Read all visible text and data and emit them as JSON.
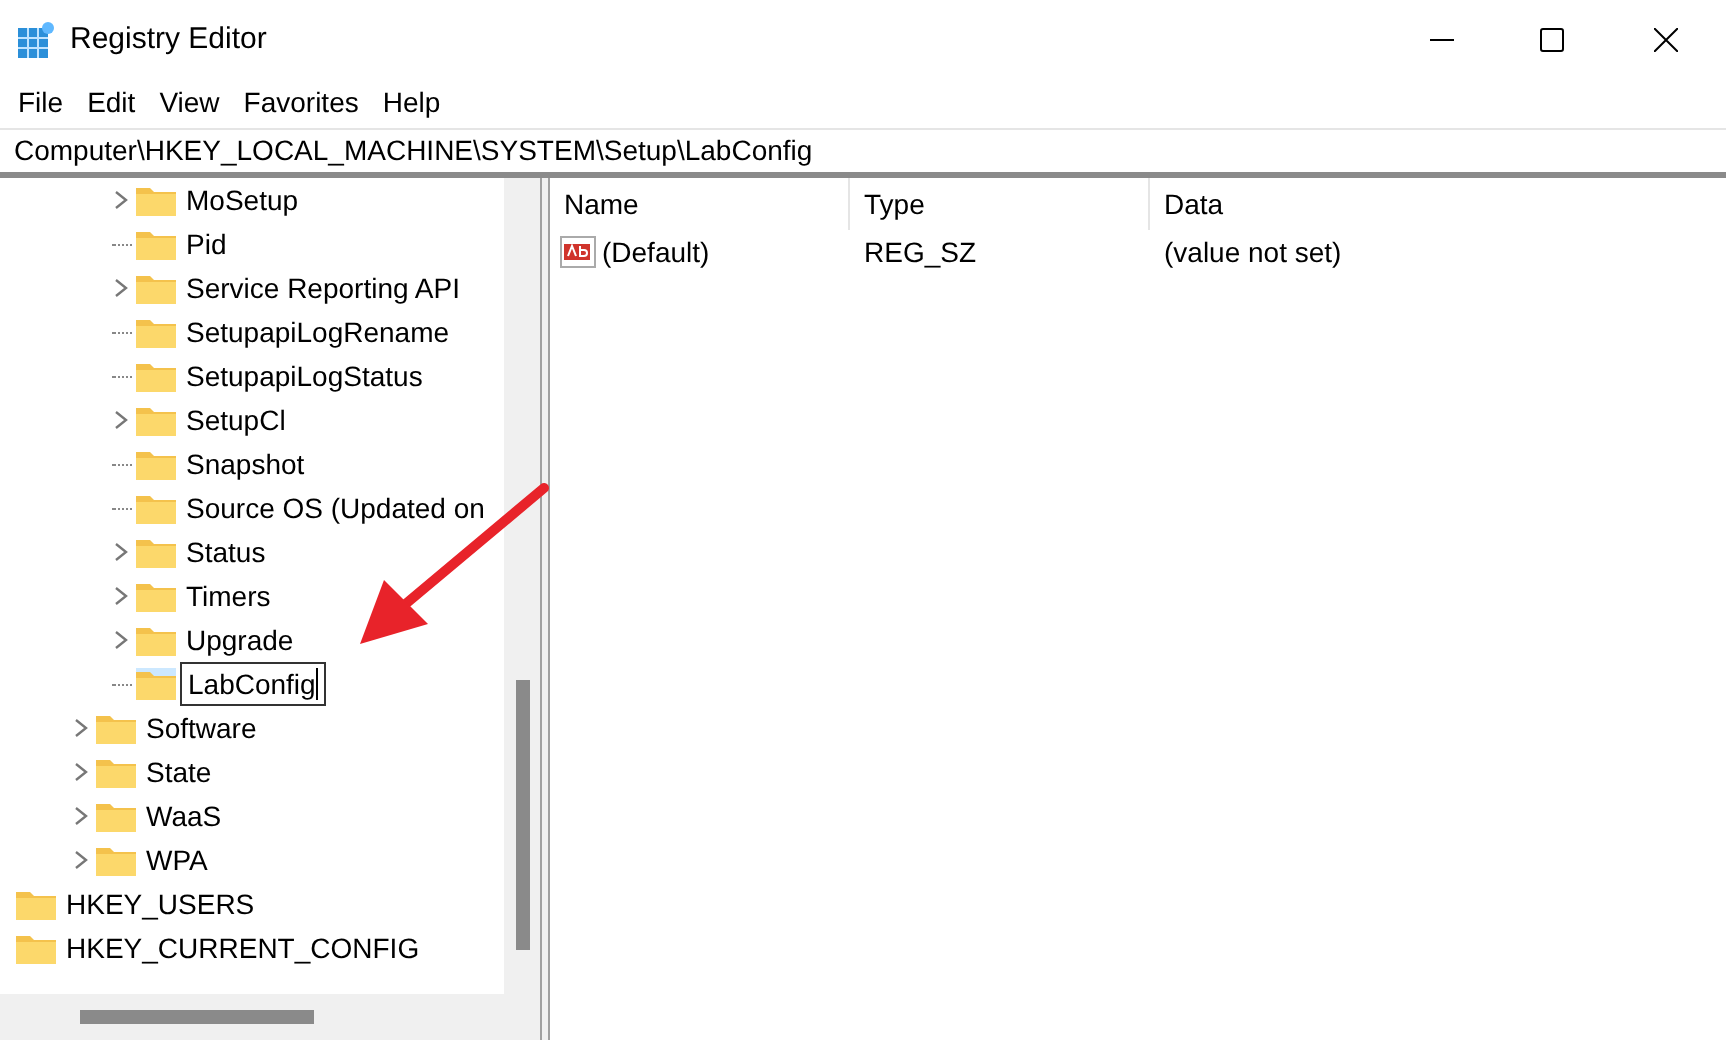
{
  "window": {
    "title": "Registry Editor"
  },
  "menu": [
    "File",
    "Edit",
    "View",
    "Favorites",
    "Help"
  ],
  "address": "Computer\\HKEY_LOCAL_MACHINE\\SYSTEM\\Setup\\LabConfig",
  "tree": [
    {
      "children": [
        {
          "children": [
            {
              "children": [
                {
                  "label": "MoSetup",
                  "expandable": true,
                  "editing": false
                },
                {
                  "label": "Pid",
                  "expandable": false,
                  "editing": false
                },
                {
                  "label": "Service Reporting API",
                  "expandable": true,
                  "editing": false
                },
                {
                  "label": "SetupapiLogRename",
                  "expandable": false,
                  "editing": false
                },
                {
                  "label": "SetupapiLogStatus",
                  "expandable": false,
                  "editing": false
                },
                {
                  "label": "SetupCl",
                  "expandable": true,
                  "editing": false
                },
                {
                  "label": "Snapshot",
                  "expandable": false,
                  "editing": false
                },
                {
                  "label": "Source OS (Updated on",
                  "expandable": false,
                  "editing": false
                },
                {
                  "label": "Status",
                  "expandable": true,
                  "editing": false
                },
                {
                  "label": "Timers",
                  "expandable": true,
                  "editing": false
                },
                {
                  "label": "Upgrade",
                  "expandable": true,
                  "editing": false
                },
                {
                  "label": "LabConfig",
                  "expandable": false,
                  "editing": true
                }
              ]
            },
            {
              "label": "Software",
              "expandable": true,
              "editing": false
            },
            {
              "label": "State",
              "expandable": true,
              "editing": false
            },
            {
              "label": "WaaS",
              "expandable": true,
              "editing": false
            },
            {
              "label": "WPA",
              "expandable": true,
              "editing": false
            }
          ]
        }
      ]
    },
    {
      "label": "HKEY_USERS",
      "expandable": false,
      "editing": false
    },
    {
      "label": "HKEY_CURRENT_CONFIG",
      "expandable": false,
      "editing": false
    }
  ],
  "table": {
    "columns": [
      "Name",
      "Type",
      "Data"
    ],
    "rows": [
      {
        "kind": "string",
        "cells": [
          "(Default)",
          "REG_SZ",
          "(value not set)"
        ]
      }
    ]
  }
}
